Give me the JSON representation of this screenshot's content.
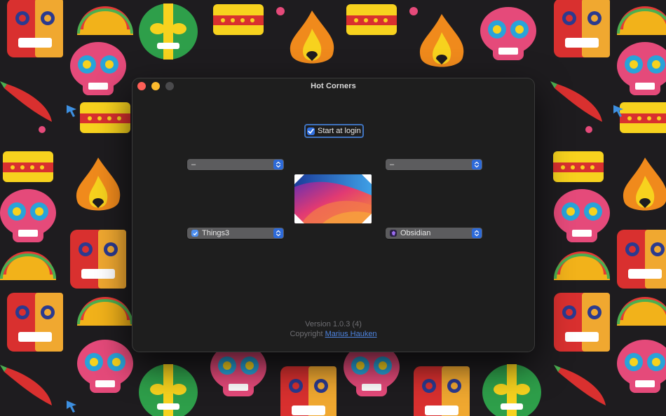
{
  "window": {
    "title": "Hot Corners"
  },
  "start_at_login": {
    "label": "Start at login",
    "checked": true
  },
  "corners": {
    "top_left": {
      "value": "–"
    },
    "top_right": {
      "value": "–"
    },
    "bottom_left": {
      "value": "Things3",
      "icon": "things3-app-icon"
    },
    "bottom_right": {
      "value": "Obsidian",
      "icon": "obsidian-app-icon"
    }
  },
  "footer": {
    "version": "Version 1.0.3 (4)",
    "copyright_prefix": "Copyright",
    "author": "Marius Hauken"
  },
  "colors": {
    "accent": "#2f6fe0",
    "link": "#4d84e0",
    "window_bg": "#1e1e1e",
    "popup_bg": "#5c5c5e",
    "close": "#ff5f57",
    "minimize": "#febc2e"
  }
}
